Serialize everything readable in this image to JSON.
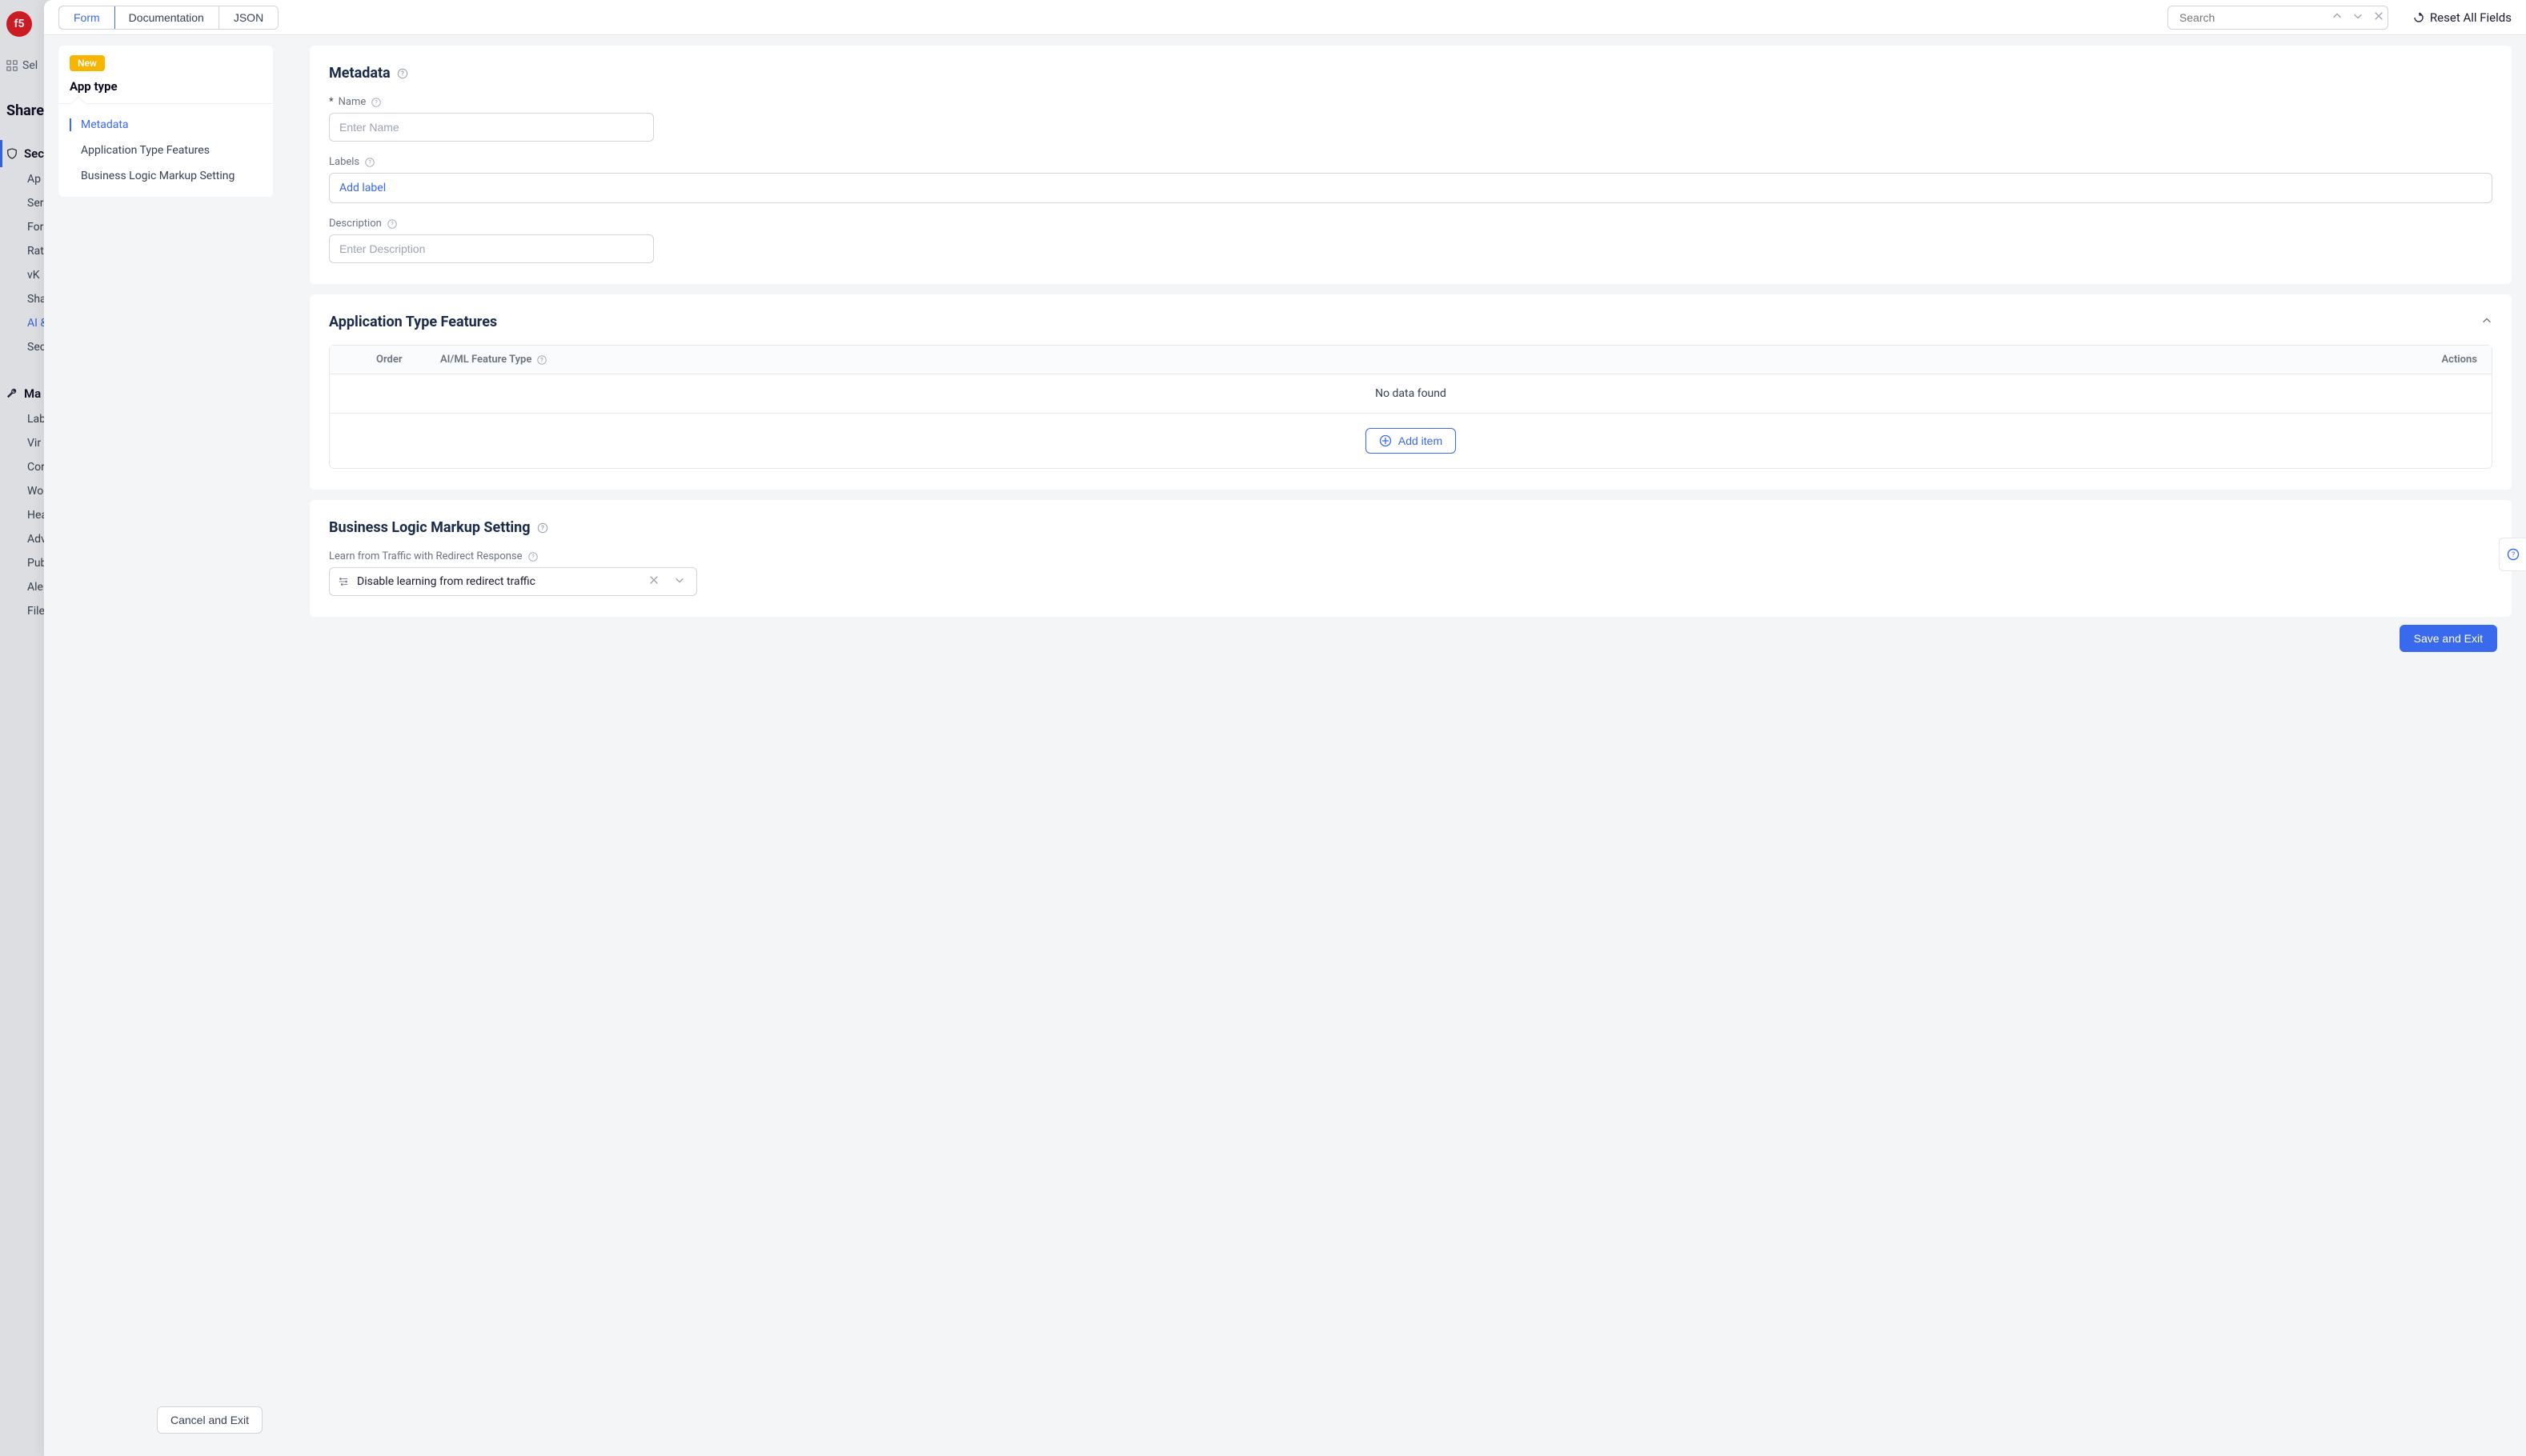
{
  "bg": {
    "logo_text": "f5",
    "selector_label": "Sel",
    "section_title": "Share",
    "nav_security_label": "Sec",
    "nav_items_top": [
      "Ap",
      "Ser",
      "For",
      "Rat",
      "vK",
      "Sha",
      "AI &",
      "Sec"
    ],
    "nav_manage_label": "Ma",
    "nav_items_bottom": [
      "Lab",
      "Vir",
      "Cor",
      "Wo",
      "Hea",
      "Adv",
      "Pub",
      "Ale",
      "File"
    ]
  },
  "toolbar": {
    "tabs": {
      "form": "Form",
      "documentation": "Documentation",
      "json": "JSON"
    },
    "search_placeholder": "Search",
    "reset_label": "Reset All Fields"
  },
  "sidebar": {
    "new_badge": "New",
    "title": "App type",
    "items": [
      {
        "label": "Metadata",
        "active": true
      },
      {
        "label": "Application Type Features",
        "active": false
      },
      {
        "label": "Business Logic Markup Setting",
        "active": false
      }
    ]
  },
  "sections": {
    "metadata": {
      "title": "Metadata",
      "name_label": "Name",
      "name_required_prefix": "*",
      "name_placeholder": "Enter Name",
      "labels_label": "Labels",
      "add_label_text": "Add label",
      "description_label": "Description",
      "description_placeholder": "Enter Description"
    },
    "features": {
      "title": "Application Type Features",
      "col_order": "Order",
      "col_type": "AI/ML Feature Type",
      "col_actions": "Actions",
      "empty_text": "No data found",
      "add_item": "Add item"
    },
    "business": {
      "title": "Business Logic Markup Setting",
      "learn_label": "Learn from Traffic with Redirect Response",
      "select_value": "Disable learning from redirect traffic"
    }
  },
  "footer": {
    "cancel": "Cancel and Exit",
    "save": "Save and Exit"
  }
}
